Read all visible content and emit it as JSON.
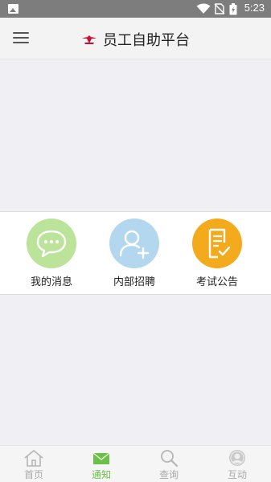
{
  "status_bar": {
    "time": "5:23",
    "icons": [
      "gallery-icon",
      "wifi-icon",
      "no-sim-icon",
      "battery-icon"
    ]
  },
  "app_bar": {
    "title": "员工自助平台",
    "menu_icon": "hamburger-menu-icon",
    "logo_icon": "airline-logo-icon"
  },
  "quick_actions": [
    {
      "label": "我的消息",
      "icon": "chat-bubble-icon",
      "color": "#bce39a"
    },
    {
      "label": "内部招聘",
      "icon": "add-user-icon",
      "color": "#b3d7ef"
    },
    {
      "label": "考试公告",
      "icon": "document-check-icon",
      "color": "#f4aa1d"
    }
  ],
  "tab_bar": {
    "active": "通知",
    "active_color": "#6cc04a",
    "tabs": [
      {
        "label": "首页",
        "icon": "home-icon"
      },
      {
        "label": "通知",
        "icon": "envelope-icon"
      },
      {
        "label": "查询",
        "icon": "search-icon"
      },
      {
        "label": "互动",
        "icon": "user-avatar-icon"
      }
    ]
  }
}
